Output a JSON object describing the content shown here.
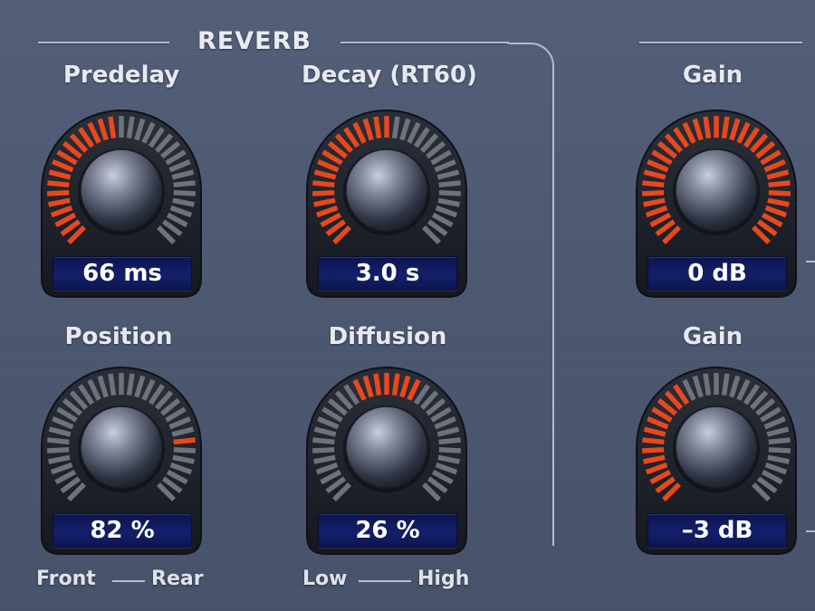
{
  "section": {
    "title": "REVERB"
  },
  "knobs": [
    {
      "id": "predelay",
      "label": "Predelay",
      "value": "66 ms",
      "level": 0.47,
      "mode": "fill"
    },
    {
      "id": "decay",
      "label": "Decay (RT60)",
      "value": "3.0 s",
      "level": 0.5,
      "mode": "fill"
    },
    {
      "id": "position",
      "label": "Position",
      "value": "82 %",
      "level": 0.82,
      "mode": "pointer"
    },
    {
      "id": "diffusion",
      "label": "Diffusion",
      "value": "26 %",
      "level": 0.5,
      "mode": "center"
    },
    {
      "id": "gain1",
      "label": "Gain",
      "value": "0 dB",
      "level": 1.0,
      "mode": "fill"
    },
    {
      "id": "gain2",
      "label": "Gain",
      "value": "–3 dB",
      "level": 0.4,
      "mode": "fill"
    }
  ],
  "range_labels": {
    "position": {
      "low": "Front",
      "high": "Rear"
    },
    "diffusion": {
      "low": "Low",
      "high": "High"
    }
  },
  "colors": {
    "active_segment": "#e8481e",
    "inactive_segment": "#6e727b",
    "background": "#4b5670",
    "readout": "#141f6a"
  }
}
